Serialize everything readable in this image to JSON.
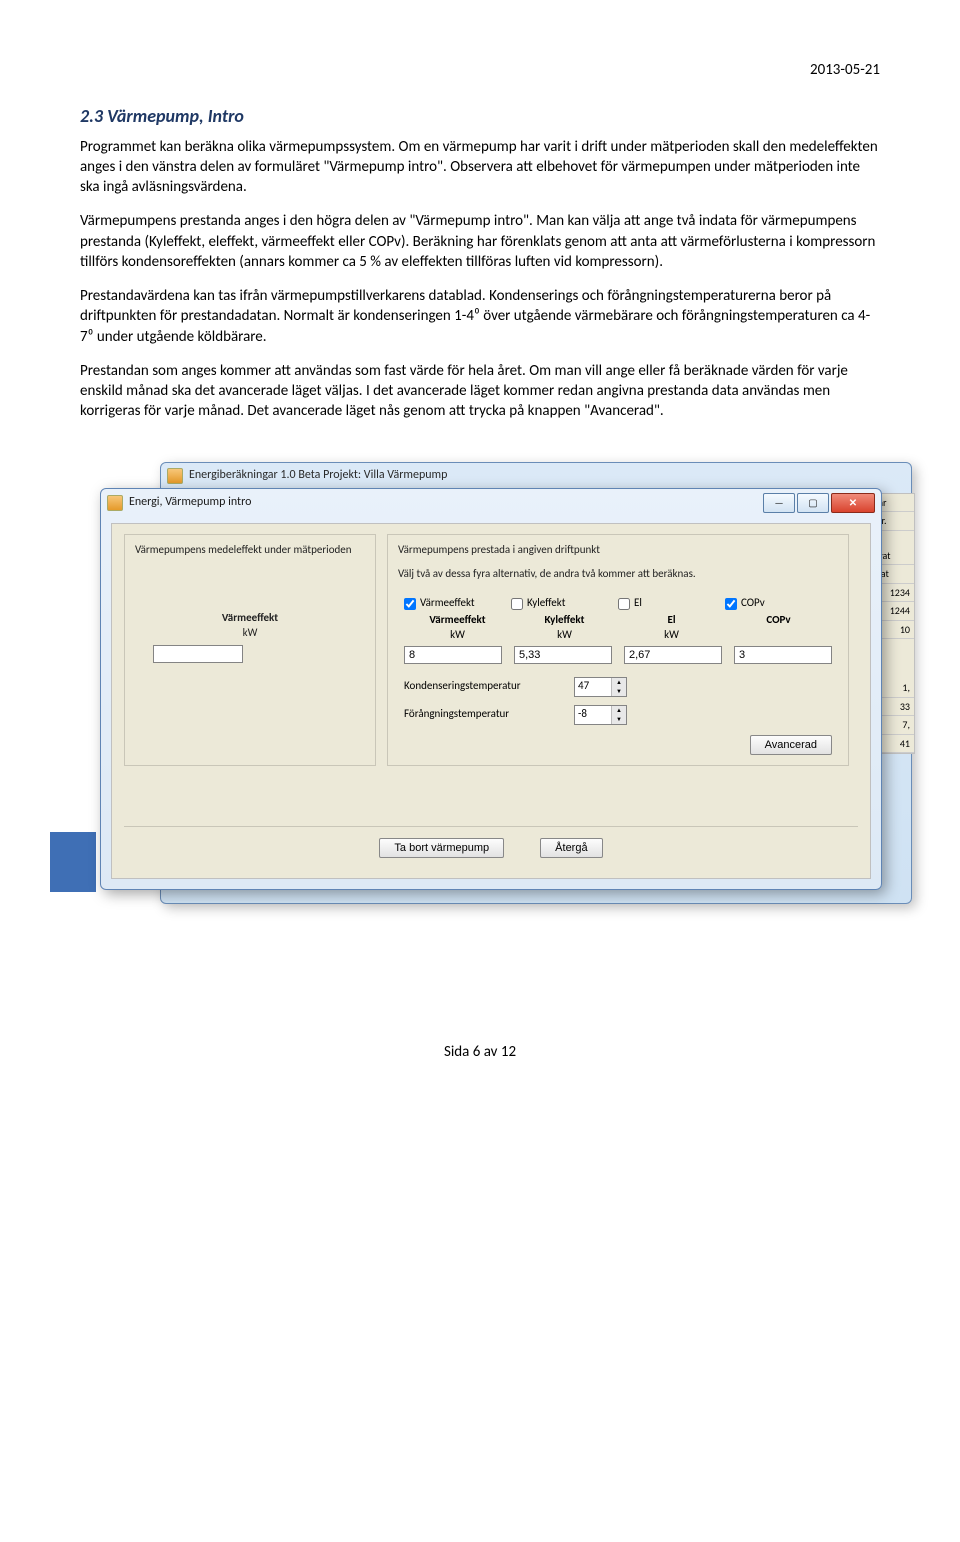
{
  "date": "2013-05-21",
  "heading": "2.3 Värmepump, Intro",
  "p1": "Programmet kan beräkna olika värmepumpssystem. Om en värmepump har varit i drift under mätperioden skall den medeleffekten anges i den vänstra delen av formuläret \"Värmepump intro\". Observera att elbehovet för värmepumpen under mätperioden inte ska ingå avläsningsvärdena.",
  "p2": "Värmepumpens prestanda anges i den högra delen av \"Värmepump intro\". Man kan välja att ange två indata för värmepumpens prestanda (Kyleffekt, eleffekt, värmeeffekt eller COPv). Beräkning har förenklats genom att anta att värmeförlusterna i kompressorn tillförs kondensoreffekten (annars kommer ca 5 % av eleffekten tillföras luften vid kompressorn).",
  "p3": "Prestandavärdena kan tas ifrån värmepumpstillverkarens datablad. Kondenserings och förångningstemperaturerna beror på driftpunkten för prestandadatan. Normalt är kondenseringen 1-4⁰ över utgående värmebärare och förångningstemperaturen ca 4-7⁰ under utgående köldbärare.",
  "p4": "Prestandan som anges kommer att användas som fast värde för hela året. Om man vill ange eller få beräknade värden för varje enskild månad ska det avancerade läget väljas. I det avancerade läget kommer redan angivna prestanda data användas men korrigeras för varje månad. Det avancerade läget nås genom att trycka på knappen \"Avancerad\".",
  "bg_window": {
    "title": "Energiberäkningar 1.0 Beta   Projekt: Villa  Värmepump"
  },
  "window": {
    "title": "Energi, Värmepump intro",
    "min": "—",
    "max": "▢",
    "close": "✕"
  },
  "left_panel": {
    "text": "Värmepumpens medeleffekt under mätperioden",
    "col_label": "Värmeeffekt",
    "col_unit": "kW",
    "input_value": ""
  },
  "right_panel": {
    "title": "Värmepumpens prestada i angiven driftpunkt",
    "instr": "Välj två av dessa fyra alternativ, de andra två kommer att beräknas.",
    "chk": {
      "varme": "Värmeeffekt",
      "kyl": "Kyleffekt",
      "el": "El",
      "cop": "COPv"
    },
    "hdr": {
      "varme": "Värmeeffekt",
      "kyl": "Kyleffekt",
      "el": "El",
      "cop": "COPv"
    },
    "unit": "kW",
    "vals": {
      "varme": "8",
      "kyl": "5,33",
      "el": "2,67",
      "cop": "3"
    },
    "kond_label": "Kondenseringstemperatur",
    "kond_val": "47",
    "forang_label": "Förångningstemperatur",
    "forang_val": "-8",
    "adv_btn": "Avancerad"
  },
  "bottom": {
    "remove": "Ta bort värmepump",
    "back": "Återgå"
  },
  "right_slice": {
    "t1": "ur när",
    "t2": "tartar.",
    "l1": "armvat",
    "l2": "Kallvat",
    "v1": "1234",
    "v2": "1244",
    "v3": "10",
    "n1": "1,",
    "n2": "33",
    "n3": "7,",
    "n4": "41"
  },
  "footer": "Sida 6 av 12"
}
